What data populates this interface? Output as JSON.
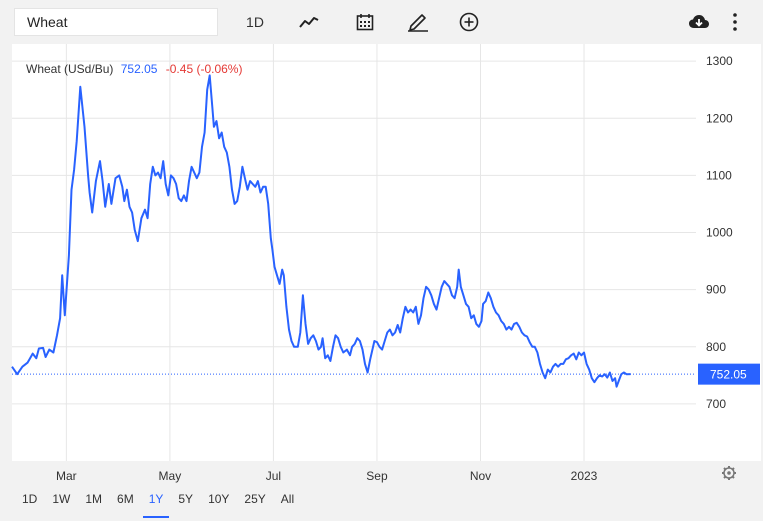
{
  "toolbar": {
    "search_value": "Wheat",
    "interval_label": "1D",
    "icons": [
      "line-chart-icon",
      "calendar-icon",
      "draw-icon",
      "add-indicator-icon",
      "download-icon",
      "more-icon"
    ]
  },
  "quote": {
    "name": "Wheat (USd/Bu)",
    "last": "752.05",
    "change": "-0.45 (-0.06%)"
  },
  "ranges": [
    "1D",
    "1W",
    "1M",
    "6M",
    "1Y",
    "5Y",
    "10Y",
    "25Y",
    "All"
  ],
  "active_range": "1Y",
  "colors": {
    "line": "#2962ff",
    "change_negative": "#e53935",
    "grid": "#e6e6e6"
  },
  "chart_data": {
    "type": "line",
    "title": "",
    "xlabel": "",
    "ylabel": "",
    "y_ticks": [
      "1300",
      "1200",
      "1100",
      "1000",
      "900",
      "800",
      "700"
    ],
    "ylim": [
      600,
      1330
    ],
    "x_ticks": [
      {
        "label": "Mar",
        "x": 2.0
      },
      {
        "label": "May",
        "x": 4.0
      },
      {
        "label": "Jul",
        "x": 6.0
      },
      {
        "label": "Sep",
        "x": 8.0
      },
      {
        "label": "Nov",
        "x": 10.0
      },
      {
        "label": "2023",
        "x": 12.0
      }
    ],
    "xlim": [
      0.95,
      13.97
    ],
    "last_value_label": "752.05",
    "last_value": 752.05,
    "series": [
      {
        "points": [
          [
            0.95,
            765
          ],
          [
            1.05,
            752
          ],
          [
            1.15,
            765
          ],
          [
            1.25,
            772
          ],
          [
            1.3,
            780
          ],
          [
            1.35,
            788
          ],
          [
            1.42,
            780
          ],
          [
            1.47,
            797
          ],
          [
            1.55,
            798
          ],
          [
            1.6,
            782
          ],
          [
            1.67,
            795
          ],
          [
            1.75,
            790
          ],
          [
            1.82,
            820
          ],
          [
            1.88,
            850
          ],
          [
            1.92,
            925
          ],
          [
            1.97,
            855
          ],
          [
            2.05,
            960
          ],
          [
            2.1,
            1075
          ],
          [
            2.15,
            1110
          ],
          [
            2.2,
            1160
          ],
          [
            2.27,
            1255
          ],
          [
            2.35,
            1185
          ],
          [
            2.42,
            1100
          ],
          [
            2.45,
            1070
          ],
          [
            2.5,
            1035
          ],
          [
            2.57,
            1090
          ],
          [
            2.65,
            1125
          ],
          [
            2.7,
            1090
          ],
          [
            2.75,
            1045
          ],
          [
            2.82,
            1085
          ],
          [
            2.87,
            1050
          ],
          [
            2.95,
            1095
          ],
          [
            3.02,
            1100
          ],
          [
            3.08,
            1080
          ],
          [
            3.12,
            1055
          ],
          [
            3.17,
            1075
          ],
          [
            3.22,
            1045
          ],
          [
            3.27,
            1035
          ],
          [
            3.32,
            1005
          ],
          [
            3.38,
            985
          ],
          [
            3.45,
            1025
          ],
          [
            3.52,
            1040
          ],
          [
            3.57,
            1025
          ],
          [
            3.62,
            1085
          ],
          [
            3.67,
            1115
          ],
          [
            3.72,
            1100
          ],
          [
            3.77,
            1105
          ],
          [
            3.82,
            1095
          ],
          [
            3.87,
            1125
          ],
          [
            3.92,
            1085
          ],
          [
            3.97,
            1065
          ],
          [
            4.02,
            1100
          ],
          [
            4.07,
            1095
          ],
          [
            4.12,
            1085
          ],
          [
            4.17,
            1060
          ],
          [
            4.22,
            1055
          ],
          [
            4.27,
            1065
          ],
          [
            4.32,
            1055
          ],
          [
            4.37,
            1090
          ],
          [
            4.42,
            1115
          ],
          [
            4.47,
            1105
          ],
          [
            4.52,
            1095
          ],
          [
            4.57,
            1105
          ],
          [
            4.62,
            1150
          ],
          [
            4.67,
            1175
          ],
          [
            4.72,
            1250
          ],
          [
            4.77,
            1275
          ],
          [
            4.82,
            1220
          ],
          [
            4.85,
            1185
          ],
          [
            4.9,
            1195
          ],
          [
            4.95,
            1165
          ],
          [
            5.0,
            1175
          ],
          [
            5.05,
            1150
          ],
          [
            5.1,
            1140
          ],
          [
            5.15,
            1115
          ],
          [
            5.2,
            1075
          ],
          [
            5.25,
            1050
          ],
          [
            5.3,
            1055
          ],
          [
            5.35,
            1080
          ],
          [
            5.4,
            1115
          ],
          [
            5.45,
            1095
          ],
          [
            5.5,
            1075
          ],
          [
            5.55,
            1090
          ],
          [
            5.6,
            1085
          ],
          [
            5.65,
            1080
          ],
          [
            5.7,
            1090
          ],
          [
            5.75,
            1070
          ],
          [
            5.8,
            1080
          ],
          [
            5.85,
            1080
          ],
          [
            5.9,
            1050
          ],
          [
            5.95,
            990
          ],
          [
            5.98,
            970
          ],
          [
            6.02,
            940
          ],
          [
            6.07,
            925
          ],
          [
            6.12,
            910
          ],
          [
            6.17,
            935
          ],
          [
            6.2,
            925
          ],
          [
            6.25,
            870
          ],
          [
            6.3,
            830
          ],
          [
            6.35,
            810
          ],
          [
            6.4,
            800
          ],
          [
            6.47,
            800
          ],
          [
            6.52,
            825
          ],
          [
            6.55,
            865
          ],
          [
            6.57,
            890
          ],
          [
            6.62,
            840
          ],
          [
            6.67,
            805
          ],
          [
            6.72,
            815
          ],
          [
            6.77,
            820
          ],
          [
            6.82,
            810
          ],
          [
            6.87,
            795
          ],
          [
            6.92,
            800
          ],
          [
            6.95,
            815
          ],
          [
            7.0,
            780
          ],
          [
            7.05,
            785
          ],
          [
            7.1,
            775
          ],
          [
            7.15,
            800
          ],
          [
            7.2,
            820
          ],
          [
            7.25,
            815
          ],
          [
            7.3,
            800
          ],
          [
            7.35,
            790
          ],
          [
            7.42,
            795
          ],
          [
            7.48,
            785
          ],
          [
            7.52,
            800
          ],
          [
            7.57,
            805
          ],
          [
            7.62,
            815
          ],
          [
            7.67,
            810
          ],
          [
            7.72,
            795
          ],
          [
            7.77,
            770
          ],
          [
            7.82,
            755
          ],
          [
            7.87,
            778
          ],
          [
            7.95,
            810
          ],
          [
            8.0,
            808
          ],
          [
            8.05,
            800
          ],
          [
            8.1,
            795
          ],
          [
            8.15,
            810
          ],
          [
            8.2,
            825
          ],
          [
            8.25,
            830
          ],
          [
            8.3,
            820
          ],
          [
            8.35,
            825
          ],
          [
            8.4,
            838
          ],
          [
            8.45,
            825
          ],
          [
            8.5,
            850
          ],
          [
            8.55,
            870
          ],
          [
            8.6,
            860
          ],
          [
            8.65,
            865
          ],
          [
            8.7,
            860
          ],
          [
            8.75,
            870
          ],
          [
            8.8,
            840
          ],
          [
            8.85,
            855
          ],
          [
            8.9,
            885
          ],
          [
            8.95,
            905
          ],
          [
            9.0,
            900
          ],
          [
            9.05,
            890
          ],
          [
            9.1,
            875
          ],
          [
            9.15,
            865
          ],
          [
            9.2,
            885
          ],
          [
            9.25,
            905
          ],
          [
            9.3,
            915
          ],
          [
            9.35,
            910
          ],
          [
            9.4,
            905
          ],
          [
            9.45,
            890
          ],
          [
            9.5,
            885
          ],
          [
            9.55,
            905
          ],
          [
            9.58,
            935
          ],
          [
            9.62,
            905
          ],
          [
            9.67,
            890
          ],
          [
            9.72,
            875
          ],
          [
            9.77,
            870
          ],
          [
            9.82,
            850
          ],
          [
            9.87,
            855
          ],
          [
            9.92,
            840
          ],
          [
            9.97,
            835
          ],
          [
            10.02,
            845
          ],
          [
            10.05,
            875
          ],
          [
            10.1,
            880
          ],
          [
            10.15,
            895
          ],
          [
            10.2,
            885
          ],
          [
            10.25,
            870
          ],
          [
            10.3,
            860
          ],
          [
            10.35,
            855
          ],
          [
            10.4,
            845
          ],
          [
            10.45,
            840
          ],
          [
            10.5,
            830
          ],
          [
            10.55,
            835
          ],
          [
            10.6,
            830
          ],
          [
            10.65,
            840
          ],
          [
            10.7,
            842
          ],
          [
            10.75,
            835
          ],
          [
            10.8,
            825
          ],
          [
            10.85,
            820
          ],
          [
            10.9,
            818
          ],
          [
            10.95,
            808
          ],
          [
            11.0,
            800
          ],
          [
            11.05,
            800
          ],
          [
            11.1,
            790
          ],
          [
            11.15,
            770
          ],
          [
            11.2,
            755
          ],
          [
            11.25,
            745
          ],
          [
            11.3,
            760
          ],
          [
            11.35,
            755
          ],
          [
            11.4,
            765
          ],
          [
            11.45,
            770
          ],
          [
            11.5,
            765
          ],
          [
            11.55,
            770
          ],
          [
            11.6,
            770
          ],
          [
            11.65,
            778
          ],
          [
            11.7,
            780
          ],
          [
            11.75,
            785
          ],
          [
            11.8,
            788
          ],
          [
            11.85,
            778
          ],
          [
            11.9,
            790
          ],
          [
            11.95,
            785
          ],
          [
            12.0,
            790
          ],
          [
            12.05,
            770
          ],
          [
            12.1,
            760
          ],
          [
            12.15,
            745
          ],
          [
            12.2,
            738
          ],
          [
            12.25,
            745
          ],
          [
            12.3,
            750
          ],
          [
            12.35,
            748
          ],
          [
            12.4,
            752
          ],
          [
            12.45,
            746
          ],
          [
            12.5,
            755
          ],
          [
            12.55,
            740
          ],
          [
            12.6,
            745
          ],
          [
            12.63,
            730
          ],
          [
            12.67,
            740
          ],
          [
            12.72,
            752
          ],
          [
            12.77,
            755
          ],
          [
            12.82,
            752
          ],
          [
            12.9,
            752.05
          ]
        ]
      }
    ]
  }
}
